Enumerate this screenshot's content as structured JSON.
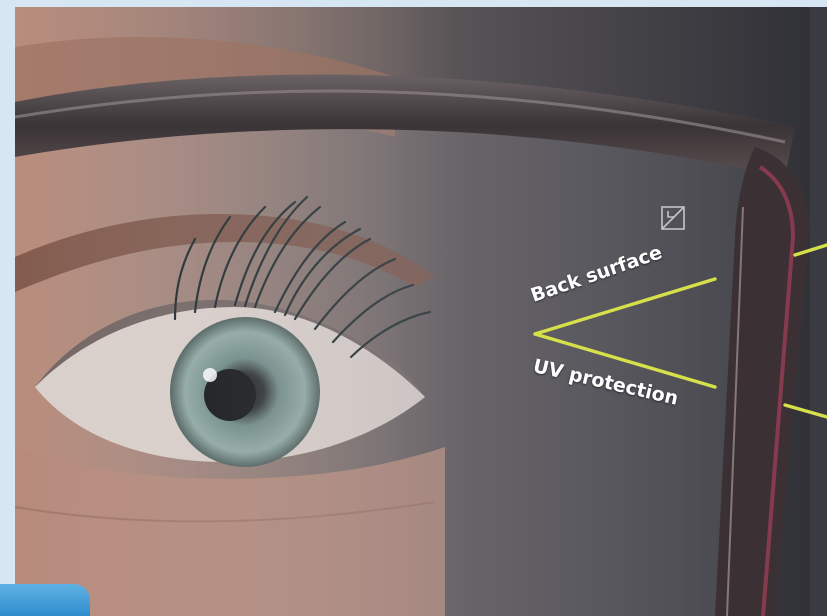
{
  "labels": {
    "back_surface": "Back surface",
    "uv_protection": "UV protection"
  },
  "colors": {
    "background_band": "#d7e6f3",
    "pointer_line": "#d6e04a",
    "label_text": "#ffffff",
    "corner_tab": "#3d9bd6"
  },
  "icons": {
    "lens_mark": "lens-engraving-icon"
  }
}
